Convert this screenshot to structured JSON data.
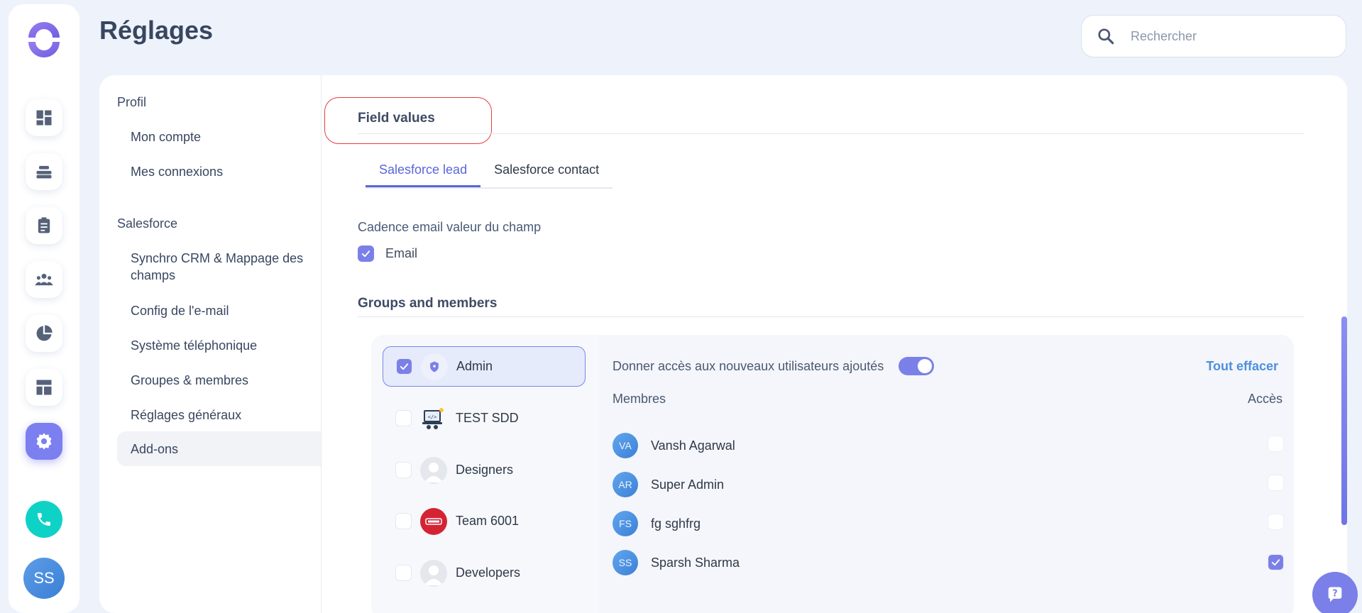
{
  "header": {
    "title": "Réglages",
    "search_placeholder": "Rechercher"
  },
  "rail": {
    "user_initials": "SS"
  },
  "nav": {
    "profil_label": "Profil",
    "profil_items": [
      "Mon compte",
      "Mes connexions"
    ],
    "salesforce_label": "Salesforce",
    "salesforce_items": [
      "Synchro CRM & Mappage des champs",
      "Config de l'e-mail",
      "Système téléphonique",
      "Groupes & membres",
      "Réglages généraux",
      "Add-ons"
    ],
    "active_item": "Add-ons"
  },
  "content": {
    "field_values_title": "Field values",
    "tabs": [
      "Salesforce lead",
      "Salesforce contact"
    ],
    "active_tab": "Salesforce lead",
    "cadence_label": "Cadence email valeur du champ",
    "email_label": "Email",
    "groups_title": "Groups and members"
  },
  "groups": [
    {
      "name": "Admin",
      "checked": true,
      "icon": "shield-icon"
    },
    {
      "name": "TEST SDD",
      "checked": false,
      "icon": "laptop-icon"
    },
    {
      "name": "Designers",
      "checked": false,
      "icon": "user-placeholder-icon"
    },
    {
      "name": "Team 6001",
      "checked": false,
      "icon": "team-badge-icon"
    },
    {
      "name": "Developers",
      "checked": false,
      "icon": "user-placeholder-icon"
    }
  ],
  "members_panel": {
    "access_new_users_label": "Donner accès aux nouveaux utilisateurs ajoutés",
    "clear_all_label": "Tout effacer",
    "members_header": "Membres",
    "access_header": "Accès",
    "members": [
      {
        "initials": "VA",
        "name": "Vansh Agarwal",
        "access": false
      },
      {
        "initials": "AR",
        "name": "Super Admin",
        "access": false
      },
      {
        "initials": "FS",
        "name": "fg sghfrg",
        "access": false
      },
      {
        "initials": "SS",
        "name": "Sparsh Sharma",
        "access": true
      }
    ]
  },
  "colors": {
    "accent": "#7b80e8",
    "link": "#4d8fe0",
    "highlight_border": "#e53c3c",
    "call": "#0fd2c6"
  }
}
